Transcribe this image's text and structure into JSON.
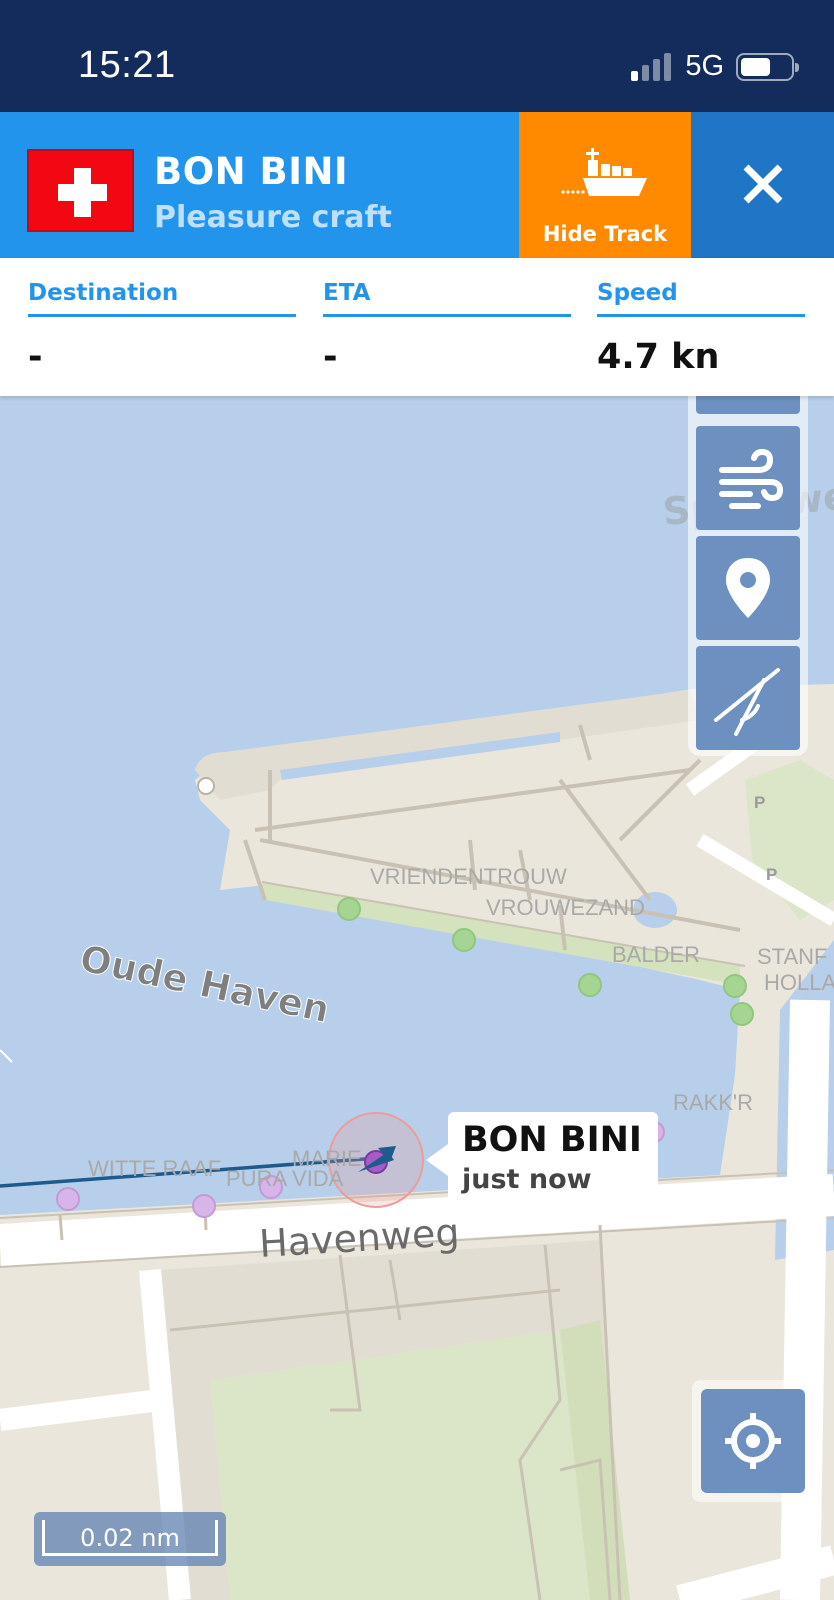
{
  "status_bar": {
    "time": "15:21",
    "network": "5G",
    "battery_level": 0.6,
    "signal_bars": 1
  },
  "vessel": {
    "name": "BON BINI",
    "type": "Pleasure craft",
    "flag": "Switzerland",
    "hide_track_label": "Hide Track",
    "close_icon": "close-icon",
    "ship_icon": "container-ship-icon"
  },
  "info": {
    "destination_label": "Destination",
    "destination_value": "-",
    "eta_label": "ETA",
    "eta_value": "-",
    "speed_label": "Speed",
    "speed_value": "4.7 kn"
  },
  "map": {
    "water_label": "Oude Haven",
    "street_havenweg": "Havenweg",
    "street_spoorweg": "Spoorwe",
    "places": [
      "VRIENDENTROUW",
      "VROUWEZAND",
      "BALDER",
      "STANF",
      "HOLLA",
      "RAKK'R",
      "WITTE RAAF",
      "PURA VIDA",
      "MARIE"
    ],
    "parking_label": "P",
    "callout_name": "BON BINI",
    "callout_time": "just now",
    "scale": "0.02 nm"
  },
  "toolbar": {
    "icons": [
      "wind-icon",
      "location-pin-icon",
      "measure-distance-icon",
      "crosshair-icon"
    ]
  },
  "colors": {
    "status_bar": "#132c5b",
    "header_blue": "#2394ec",
    "hide_track_orange": "#ff8a00",
    "close_blue": "#1f75c6",
    "water": "#b7cfea",
    "land": "#ebe6db",
    "park": "#dbe6c8",
    "toolbar_button": "#6d90c0"
  }
}
